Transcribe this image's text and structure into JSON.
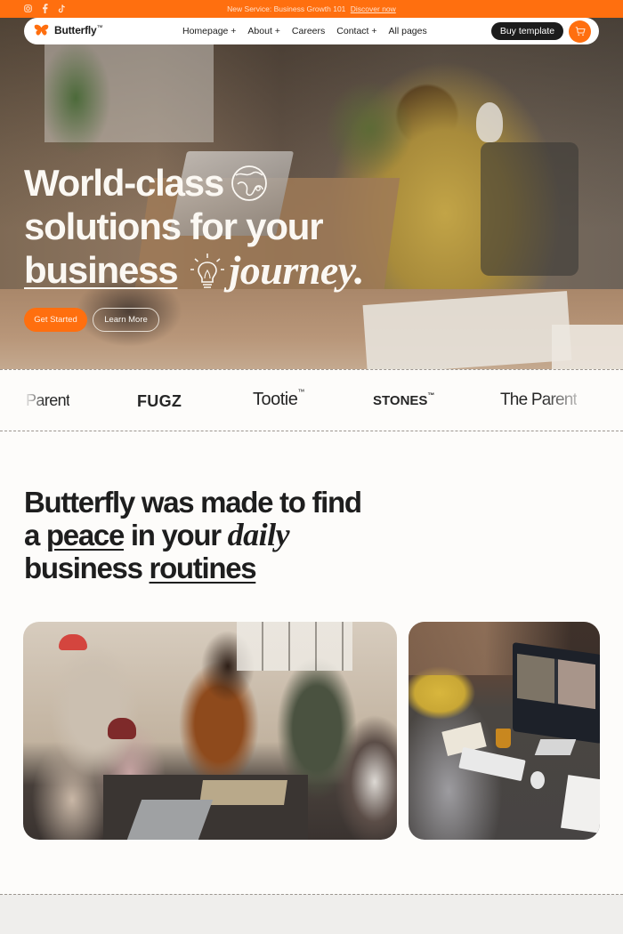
{
  "announcement": {
    "text": "New Service: Business Growth 101",
    "link": "Discover now",
    "socials": [
      "instagram-icon",
      "facebook-icon",
      "tiktok-icon"
    ]
  },
  "nav": {
    "brand": "Butterfly",
    "brand_mark": "™",
    "items": [
      "Homepage +",
      "About +",
      "Careers",
      "Contact +",
      "All pages"
    ],
    "buy_label": "Buy template",
    "cart_icon": "cart-icon"
  },
  "hero": {
    "line1": "World-class",
    "line2": "solutions for your",
    "line3_underlined": "business",
    "line3_italic": "journey.",
    "icon1": "globe-icon",
    "icon2": "lightbulb-icon",
    "primary_cta": "Get Started",
    "secondary_cta": "Learn More"
  },
  "logos": [
    {
      "name": "Parent",
      "tm": ""
    },
    {
      "name": "FUGZ",
      "tm": ""
    },
    {
      "name": "Tootie",
      "tm": "™"
    },
    {
      "name": "STONES",
      "tm": "™"
    },
    {
      "name": "The Parent",
      "tm": ""
    }
  ],
  "about": {
    "line1": "Butterfly was made to find",
    "line2_a": "a ",
    "line2_underlined": "peace",
    "line2_b": " in your ",
    "line2_italic": "daily",
    "line3_a": "business ",
    "line3_underlined": "routines"
  },
  "photos": [
    {
      "alt": "Team meeting around a table"
    },
    {
      "alt": "Person on a video call at desk"
    }
  ],
  "colors": {
    "accent": "#ff6f0f",
    "dark": "#1c1c1c",
    "background": "#fdfcfa"
  }
}
